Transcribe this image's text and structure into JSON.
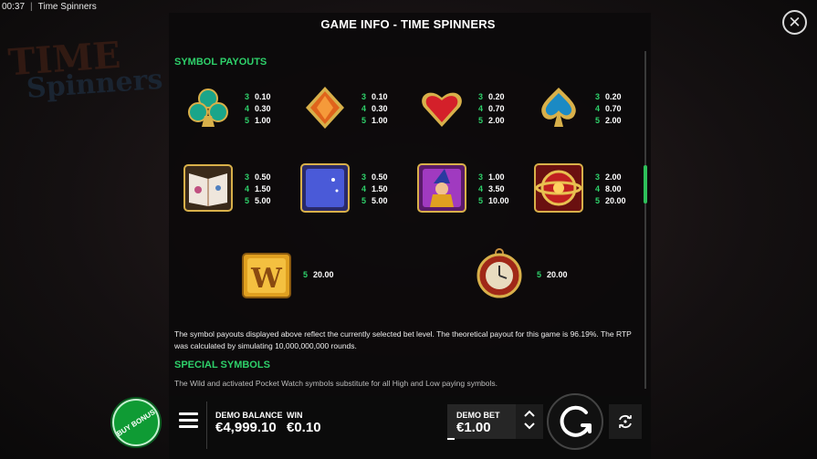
{
  "window": {
    "time": "00:37",
    "separator": "|",
    "app_title": "Time Spinners"
  },
  "background": {
    "logo_line1": "TIME",
    "logo_line2": "Spinners"
  },
  "panel": {
    "title": "GAME INFO - TIME SPINNERS",
    "close_icon": "close-icon",
    "accent_color": "#2ed06a"
  },
  "symbol_payouts": {
    "heading": "SYMBOL PAYOUTS",
    "rows": [
      [
        {
          "icon": "club-gem-icon",
          "pays": [
            [
              "3",
              "0.10"
            ],
            [
              "4",
              "0.30"
            ],
            [
              "5",
              "1.00"
            ]
          ]
        },
        {
          "icon": "diamond-gem-icon",
          "pays": [
            [
              "3",
              "0.10"
            ],
            [
              "4",
              "0.30"
            ],
            [
              "5",
              "1.00"
            ]
          ]
        },
        {
          "icon": "heart-gem-icon",
          "pays": [
            [
              "3",
              "0.20"
            ],
            [
              "4",
              "0.70"
            ],
            [
              "5",
              "2.00"
            ]
          ]
        },
        {
          "icon": "spade-gem-icon",
          "pays": [
            [
              "3",
              "0.20"
            ],
            [
              "4",
              "0.70"
            ],
            [
              "5",
              "2.00"
            ]
          ]
        }
      ],
      [
        {
          "icon": "spell-book-icon",
          "pays": [
            [
              "3",
              "0.50"
            ],
            [
              "4",
              "1.50"
            ],
            [
              "5",
              "5.00"
            ]
          ]
        },
        {
          "icon": "magic-scroll-icon",
          "pays": [
            [
              "3",
              "0.50"
            ],
            [
              "4",
              "1.50"
            ],
            [
              "5",
              "5.00"
            ]
          ]
        },
        {
          "icon": "wizard-icon",
          "pays": [
            [
              "3",
              "1.00"
            ],
            [
              "4",
              "3.50"
            ],
            [
              "5",
              "10.00"
            ]
          ]
        },
        {
          "icon": "golden-orb-icon",
          "pays": [
            [
              "3",
              "2.00"
            ],
            [
              "4",
              "8.00"
            ],
            [
              "5",
              "20.00"
            ]
          ]
        }
      ],
      [
        {
          "icon": "wild-w-icon",
          "pays": [
            [
              "5",
              "20.00"
            ]
          ]
        },
        {
          "icon": "pocket-watch-icon",
          "pays": [
            [
              "5",
              "20.00"
            ]
          ]
        }
      ]
    ]
  },
  "payout_note": "The symbol payouts displayed above reflect the currently selected bet level. The theoretical payout for this game is 96.19%. The RTP was calculated by simulating 10,000,000,000 rounds.",
  "special_symbols": {
    "heading": "SPECIAL SYMBOLS",
    "text": "The Wild and activated Pocket Watch symbols substitute for all High and Low paying symbols."
  },
  "bottom_bar": {
    "buy_bonus_label": "BUY BONUS",
    "menu_icon": "hamburger-menu-icon",
    "balance_label": "DEMO BALANCE",
    "balance_value": "€4,999.10",
    "win_label": "WIN",
    "win_value": "€0.10",
    "bet_label": "DEMO BET",
    "bet_value": "€1.00",
    "bet_up_icon": "chevron-up-icon",
    "bet_down_icon": "chevron-down-icon",
    "spin_icon": "spin-arrow-icon",
    "autoplay_icon": "autoplay-icon",
    "buy_color": "#0f9b34"
  }
}
